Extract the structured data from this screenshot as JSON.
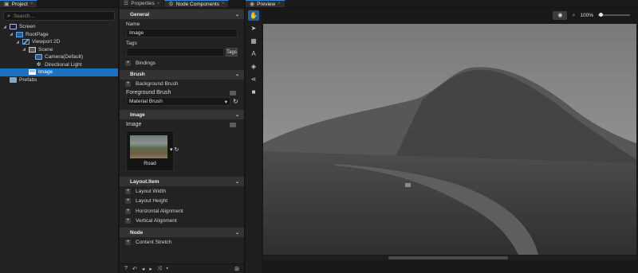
{
  "project": {
    "tab_label": "Project",
    "search_placeholder": "Search...",
    "tree": [
      {
        "label": "Screen",
        "icon": "screen-icon"
      },
      {
        "label": "RootPage",
        "icon": "page-icon"
      },
      {
        "label": "Viewport 2D",
        "icon": "viewport-icon"
      },
      {
        "label": "Scene",
        "icon": "scene-icon"
      },
      {
        "label": "Camera(Default)",
        "icon": "camera-icon"
      },
      {
        "label": "Directional Light",
        "icon": "light-icon"
      },
      {
        "label": "Image",
        "icon": "image-icon",
        "selected": true
      },
      {
        "label": "Prefabs",
        "icon": "folder-icon"
      }
    ]
  },
  "properties": {
    "tab_properties": "Properties",
    "tab_node_components": "Node Components",
    "general": {
      "title": "General",
      "name_label": "Name",
      "name_value": "Image",
      "tags_label": "Tags",
      "tags_value": "",
      "tags_button": "Tags",
      "bindings_label": "Bindings"
    },
    "brush": {
      "title": "Brush",
      "background_brush": "Background Brush",
      "foreground_brush_label": "Foreground Brush",
      "foreground_brush_value": "Material Brush"
    },
    "image": {
      "title": "Image",
      "image_label": "Image",
      "thumbnail_caption": "Road"
    },
    "layout_item": {
      "title": "Layout.Item",
      "items": [
        "Layout Width",
        "Layout Height",
        "Horizontal Alignment",
        "Vertical Alignment"
      ]
    },
    "node": {
      "title": "Node",
      "items": [
        "Content Stretch"
      ]
    }
  },
  "preview": {
    "tab_label": "Preview",
    "zoom_level": "100%",
    "zoom_slider_fraction": 0.05,
    "scroll_fraction": 0.33
  },
  "colors": {
    "accent": "#1c71c2",
    "panel": "#222222",
    "section_header": "#333333"
  }
}
